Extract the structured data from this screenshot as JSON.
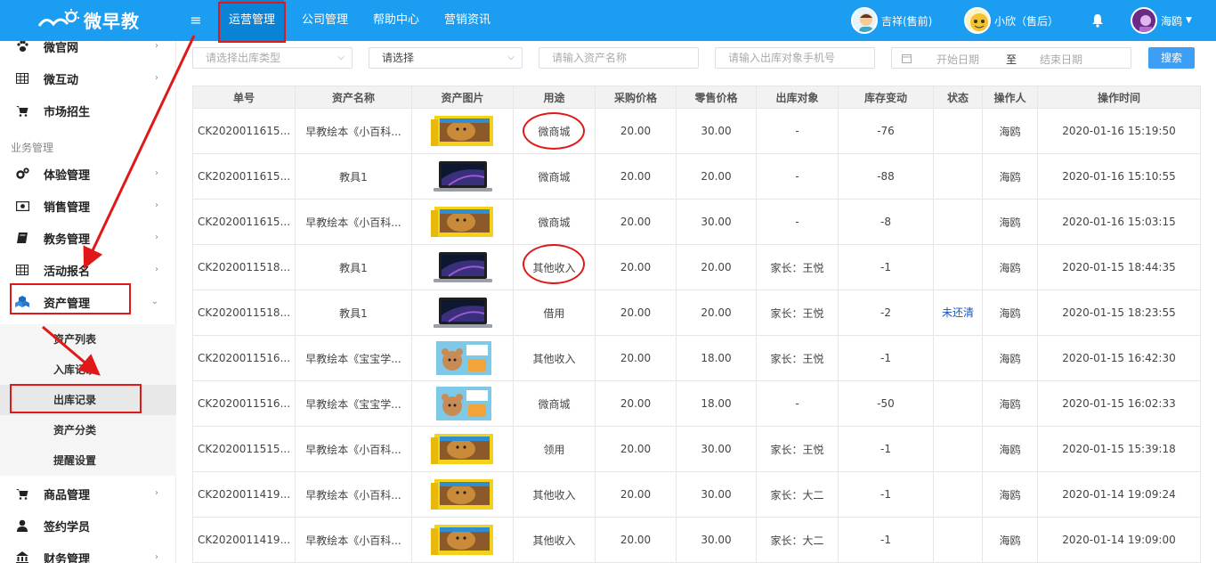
{
  "brand": {
    "name": "微早教"
  },
  "topnav": {
    "tabs": [
      "运营管理",
      "公司管理",
      "帮助中心",
      "营销资讯"
    ],
    "active": 0
  },
  "users": [
    {
      "name": "吉祥(售前)"
    },
    {
      "name": "小欣（售后）"
    },
    {
      "name": "海鸥"
    }
  ],
  "sidebar": {
    "top_items": [
      {
        "label": "微官网",
        "icon": "paw-icon"
      },
      {
        "label": "微互动",
        "icon": "grid-icon"
      },
      {
        "label": "市场招生",
        "icon": "cart-icon"
      }
    ],
    "group_label": "业务管理",
    "group_items": [
      {
        "label": "体验管理",
        "icon": "gears-icon"
      },
      {
        "label": "销售管理",
        "icon": "money-icon"
      },
      {
        "label": "教务管理",
        "icon": "book-icon"
      },
      {
        "label": "活动报名",
        "icon": "grid-icon"
      },
      {
        "label": "资产管理",
        "icon": "cubes-icon",
        "expanded": true
      }
    ],
    "sub_items": [
      "资产列表",
      "入库记录",
      "出库记录",
      "资产分类",
      "提醒设置"
    ],
    "active_sub": 2,
    "bottom_items": [
      {
        "label": "商品管理",
        "icon": "cart-icon"
      },
      {
        "label": "签约学员",
        "icon": "user-icon"
      },
      {
        "label": "财务管理",
        "icon": "bank-icon"
      }
    ]
  },
  "filters": {
    "out_type_placeholder": "请选择出库类型",
    "select_value": "请选择",
    "asset_name_placeholder": "请输入资产名称",
    "phone_placeholder": "请输入出库对象手机号",
    "start_date": "开始日期",
    "date_sep": "至",
    "end_date": "结束日期",
    "search_label": "搜索"
  },
  "table": {
    "headers": [
      "单号",
      "资产名称",
      "资产图片",
      "用途",
      "采购价格",
      "零售价格",
      "出库对象",
      "库存变动",
      "状态",
      "操作人",
      "操作时间"
    ],
    "rows": [
      {
        "no": "CK2020011615...",
        "name": "早教绘本《小百科...",
        "img": "lion",
        "use": "微商城",
        "buy": "20.00",
        "sell": "30.00",
        "target": "-",
        "change": "-76",
        "status": "",
        "op": "海鸥",
        "time": "2020-01-16 15:19:50"
      },
      {
        "no": "CK2020011615...",
        "name": "教具1",
        "img": "laptop",
        "use": "微商城",
        "buy": "20.00",
        "sell": "20.00",
        "target": "-",
        "change": "-88",
        "status": "",
        "op": "海鸥",
        "time": "2020-01-16 15:10:55"
      },
      {
        "no": "CK2020011615...",
        "name": "早教绘本《小百科...",
        "img": "lion",
        "use": "微商城",
        "buy": "20.00",
        "sell": "30.00",
        "target": "-",
        "change": "-8",
        "status": "",
        "op": "海鸥",
        "time": "2020-01-16 15:03:15"
      },
      {
        "no": "CK2020011518...",
        "name": "教具1",
        "img": "laptop",
        "use": "其他收入",
        "buy": "20.00",
        "sell": "20.00",
        "target": "家长：王悦",
        "change": "-1",
        "status": "",
        "op": "海鸥",
        "time": "2020-01-15 18:44:35"
      },
      {
        "no": "CK2020011518...",
        "name": "教具1",
        "img": "laptop",
        "use": "借用",
        "buy": "20.00",
        "sell": "20.00",
        "target": "家长：王悦",
        "change": "-2",
        "status": "未还清",
        "op": "海鸥",
        "time": "2020-01-15 18:23:55"
      },
      {
        "no": "CK2020011516...",
        "name": "早教绘本《宝宝学...",
        "img": "bear",
        "use": "其他收入",
        "buy": "20.00",
        "sell": "18.00",
        "target": "家长：王悦",
        "change": "-1",
        "status": "",
        "op": "海鸥",
        "time": "2020-01-15 16:42:30"
      },
      {
        "no": "CK2020011516...",
        "name": "早教绘本《宝宝学...",
        "img": "bear",
        "use": "微商城",
        "buy": "20.00",
        "sell": "18.00",
        "target": "-",
        "change": "-50",
        "status": "",
        "op": "海鸥",
        "time": "2020-01-15 16:02:33"
      },
      {
        "no": "CK2020011515...",
        "name": "早教绘本《小百科...",
        "img": "lion",
        "use": "领用",
        "buy": "20.00",
        "sell": "30.00",
        "target": "家长：王悦",
        "change": "-1",
        "status": "",
        "op": "海鸥",
        "time": "2020-01-15 15:39:18"
      },
      {
        "no": "CK2020011419...",
        "name": "早教绘本《小百科...",
        "img": "lion",
        "use": "其他收入",
        "buy": "20.00",
        "sell": "30.00",
        "target": "家长：大二",
        "change": "-1",
        "status": "",
        "op": "海鸥",
        "time": "2020-01-14 19:09:24"
      },
      {
        "no": "CK2020011419...",
        "name": "早教绘本《小百科...",
        "img": "lion",
        "use": "其他收入",
        "buy": "20.00",
        "sell": "30.00",
        "target": "家长：大二",
        "change": "-1",
        "status": "",
        "op": "海鸥",
        "time": "2020-01-14 19:09:00"
      }
    ]
  },
  "colors": {
    "primary": "#1b9df2",
    "annotation": "#e01818",
    "status_link": "#1a55c2"
  }
}
